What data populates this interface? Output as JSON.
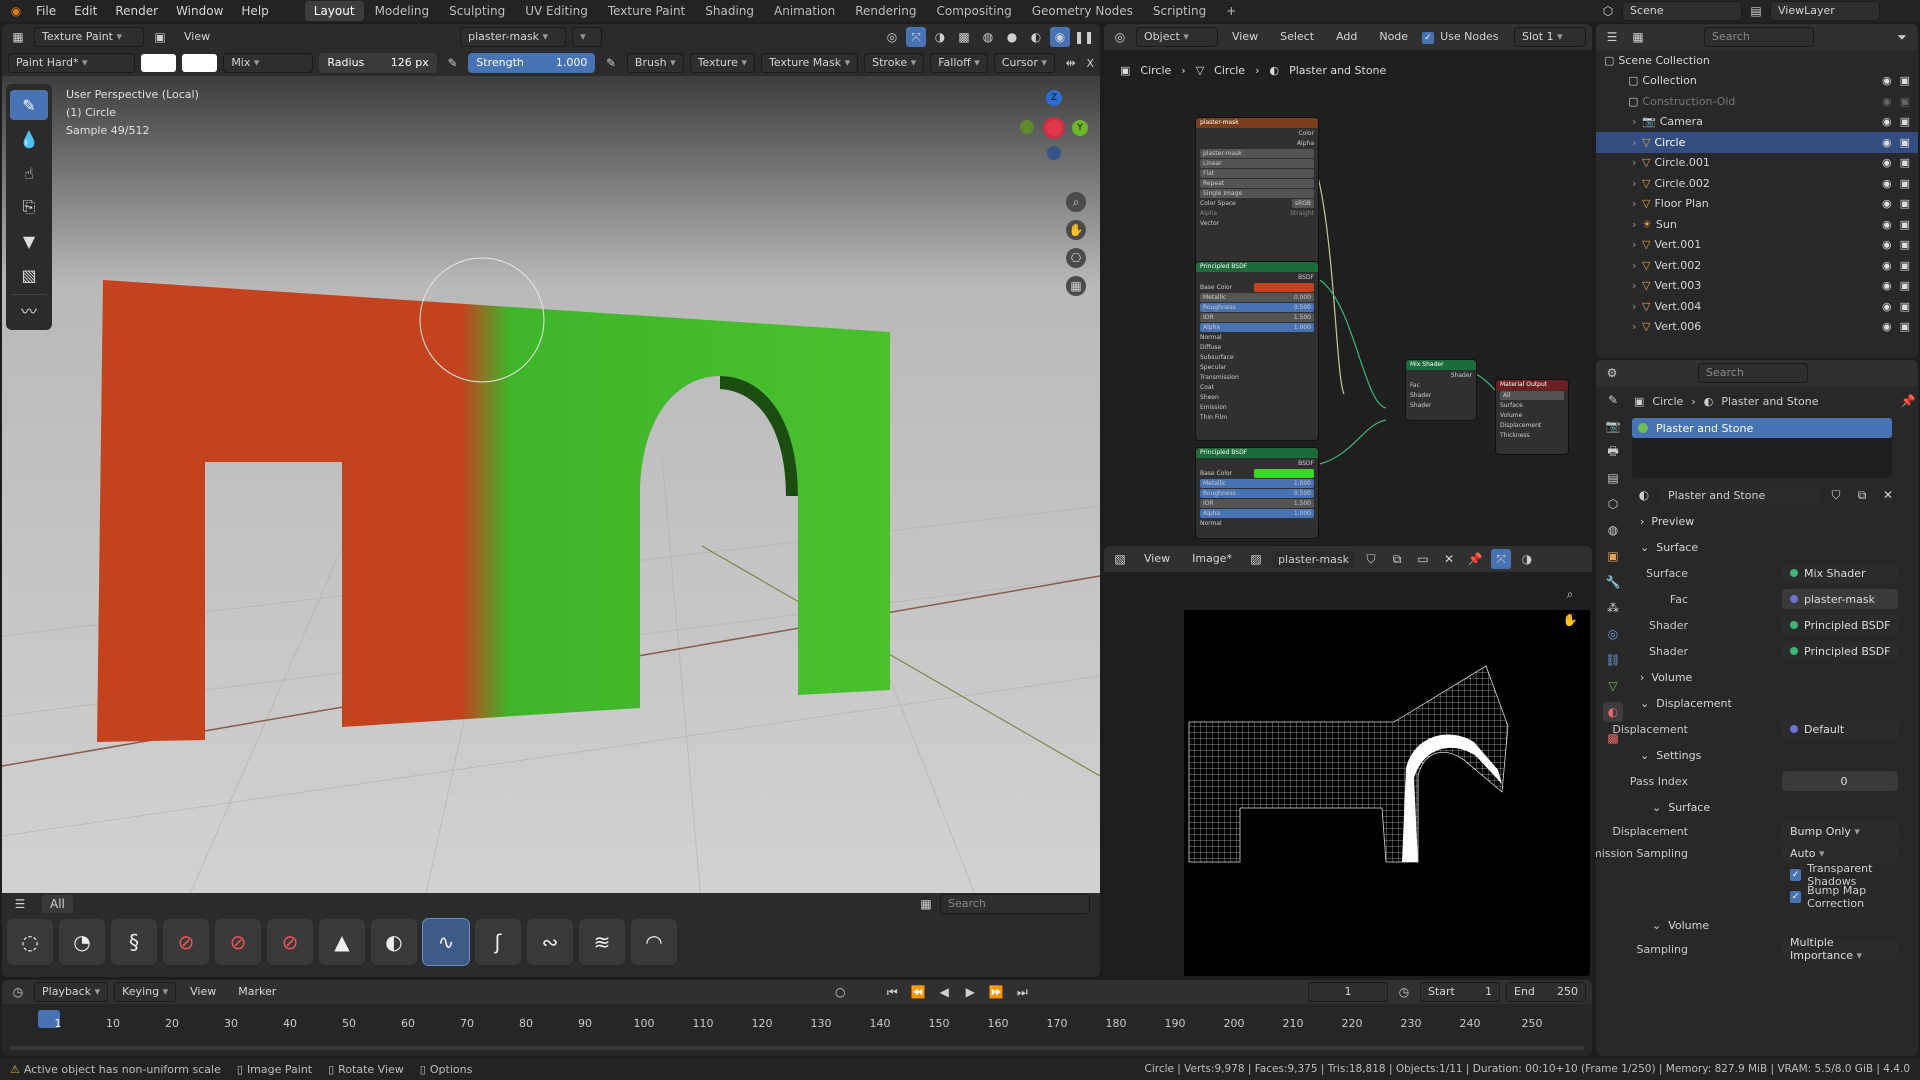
{
  "topbar": {
    "menus": [
      "File",
      "Edit",
      "Render",
      "Window",
      "Help"
    ],
    "workspaces": [
      "Layout",
      "Modeling",
      "Sculpting",
      "UV Editing",
      "Texture Paint",
      "Shading",
      "Animation",
      "Rendering",
      "Compositing",
      "Geometry Nodes",
      "Scripting"
    ],
    "active_workspace": "Layout",
    "add_tab": "+",
    "scene": "Scene",
    "view_layer": "ViewLayer"
  },
  "viewport": {
    "mode": "Texture Paint",
    "view_menu": "View",
    "texture_slot": "plaster-mask",
    "brush_name": "Paint Hard*",
    "blend": "Mix",
    "radius_label": "Radius",
    "radius_value": "126 px",
    "strength_label": "Strength",
    "strength_value": "1.000",
    "dropdowns": [
      "Brush",
      "Texture",
      "Texture Mask",
      "Stroke",
      "Falloff",
      "Cursor"
    ],
    "info_line1": "User Perspective (Local)",
    "info_line2": "(1) Circle",
    "info_line3": "Sample 49/512",
    "axis_x": "X",
    "axis_y": "Y",
    "axis_z": "Z",
    "colors": {
      "red": "#c4431f",
      "green": "#3fb52a",
      "floor": "#c7c7c7"
    }
  },
  "asset_shelf": {
    "tab_all": "All",
    "search_placeholder": "Search",
    "brush_icons": [
      "airbrush",
      "blur",
      "clone",
      "erase-hard",
      "erase-hard-pressure",
      "erase-soft",
      "fill",
      "mask",
      "paint-hard",
      "paint-hard-pressure",
      "paint-soft",
      "smear",
      "paint-soft-pressure"
    ],
    "active_index": 8
  },
  "node_editor": {
    "object_mode": "Object",
    "menus": [
      "View",
      "Select",
      "Add",
      "Node"
    ],
    "use_nodes_label": "Use Nodes",
    "slot": "Slot 1",
    "breadcrumb": [
      "Circle",
      "Circle",
      "Plaster and Stone"
    ],
    "image_node": {
      "title": "plaster-mask",
      "image": "plaster-mask",
      "rows": [
        "Linear",
        "Flat",
        "Repeat",
        "Single Image"
      ],
      "color_space_label": "Color Space",
      "color_space": "sRGB",
      "out_color": "Color",
      "out_alpha": "Alpha",
      "alpha_label": "Alpha",
      "alpha_mode": "Straight",
      "vector": "Vector"
    },
    "bsdf1": {
      "title": "Principled BSDF",
      "out": "BSDF",
      "rows": [
        [
          "Base Color",
          ""
        ],
        [
          "Metallic",
          "0.000"
        ],
        [
          "Roughness",
          "0.500"
        ],
        [
          "IOR",
          "1.500"
        ],
        [
          "Alpha",
          "1.000"
        ]
      ],
      "sub": [
        "Normal",
        "Diffuse",
        "Subsurface",
        "Specular",
        "Transmission",
        "Coat",
        "Sheen",
        "Emission",
        "Thin Film"
      ]
    },
    "bsdf2": {
      "title": "Principled BSDF",
      "out": "BSDF",
      "rows": [
        [
          "Base Color",
          ""
        ],
        [
          "Metallic",
          "1.000"
        ],
        [
          "Roughness",
          "0.500"
        ],
        [
          "IOR",
          "1.500"
        ],
        [
          "Alpha",
          "1.000"
        ]
      ],
      "sub": [
        "Normal"
      ]
    },
    "mix_node": {
      "title": "Mix Shader",
      "out": "Shader",
      "inputs": [
        "Fac",
        "Shader",
        "Shader"
      ]
    },
    "output_node": {
      "title": "Material Output",
      "target": "All",
      "inputs": [
        "Surface",
        "Volume",
        "Displacement",
        "Thickness"
      ]
    }
  },
  "image_editor": {
    "menus": [
      "View",
      "Image*"
    ],
    "image_name": "plaster-mask"
  },
  "outliner": {
    "search_placeholder": "Search",
    "root": "Scene Collection",
    "items": [
      {
        "name": "Collection",
        "type": "collection",
        "dim": false,
        "indent": 1
      },
      {
        "name": "Construction-Old",
        "type": "collection",
        "dim": true,
        "indent": 1
      },
      {
        "name": "Camera",
        "type": "camera",
        "dim": false,
        "indent": 2
      },
      {
        "name": "Circle",
        "type": "mesh",
        "dim": false,
        "indent": 2,
        "selected": true
      },
      {
        "name": "Circle.001",
        "type": "mesh",
        "dim": false,
        "indent": 2
      },
      {
        "name": "Circle.002",
        "type": "mesh",
        "dim": false,
        "indent": 2
      },
      {
        "name": "Floor Plan",
        "type": "mesh",
        "dim": false,
        "indent": 2
      },
      {
        "name": "Sun",
        "type": "light",
        "dim": false,
        "indent": 2
      },
      {
        "name": "Vert.001",
        "type": "mesh",
        "dim": false,
        "indent": 2
      },
      {
        "name": "Vert.002",
        "type": "mesh",
        "dim": false,
        "indent": 2
      },
      {
        "name": "Vert.003",
        "type": "mesh",
        "dim": false,
        "indent": 2
      },
      {
        "name": "Vert.004",
        "type": "mesh",
        "dim": false,
        "indent": 2
      },
      {
        "name": "Vert.006",
        "type": "mesh",
        "dim": false,
        "indent": 2
      }
    ]
  },
  "properties": {
    "search_placeholder": "Search",
    "breadcrumb": [
      "Circle",
      "Plaster and Stone"
    ],
    "material_slot": "Plaster and Stone",
    "material_name": "Plaster and Stone",
    "sections": {
      "preview": "Preview",
      "surface": "Surface",
      "volume": "Volume",
      "displacement": "Displacement",
      "settings": "Settings",
      "surface_sub": "Surface",
      "volume_sub": "Volume"
    },
    "surface_label": "Surface",
    "surface_value": "Mix Shader",
    "fac_label": "Fac",
    "fac_value": "plaster-mask",
    "shader1_label": "Shader",
    "shader1_value": "Principled BSDF",
    "shader2_label": "Shader",
    "shader2_value": "Principled BSDF",
    "displacement_label": "Displacement",
    "displacement_value": "Default",
    "pass_index_label": "Pass Index",
    "pass_index_value": "0",
    "disp_method_label": "Displacement",
    "disp_method_value": "Bump Only",
    "emission_sampling_label": "Emission Sampling",
    "emission_sampling_value": "Auto",
    "transparent_shadows": "Transparent Shadows",
    "bump_map_correction": "Bump Map Correction",
    "sampling_label": "Sampling",
    "sampling_value": "Multiple Importance"
  },
  "timeline": {
    "menus": [
      "Playback",
      "Keying",
      "View",
      "Marker"
    ],
    "current_frame": "1",
    "start_label": "Start",
    "start": "1",
    "end_label": "End",
    "end": "250",
    "ticks": [
      "1",
      "10",
      "20",
      "30",
      "40",
      "50",
      "60",
      "70",
      "80",
      "90",
      "100",
      "110",
      "120",
      "130",
      "140",
      "150",
      "160",
      "170",
      "180",
      "190",
      "200",
      "210",
      "220",
      "230",
      "240",
      "250"
    ]
  },
  "statusbar": {
    "warning": "Active object has non-uniform scale",
    "hint1": "Image Paint",
    "hint2": "Rotate View",
    "hint3": "Options",
    "stats": "Circle | Verts:9,978 | Faces:9,375 | Tris:18,818 | Objects:1/11 | Duration: 00:10+10 (Frame 1/250) | Memory: 827.9 MiB | VRAM: 5.5/8.0 GiB | 4.4.0"
  }
}
